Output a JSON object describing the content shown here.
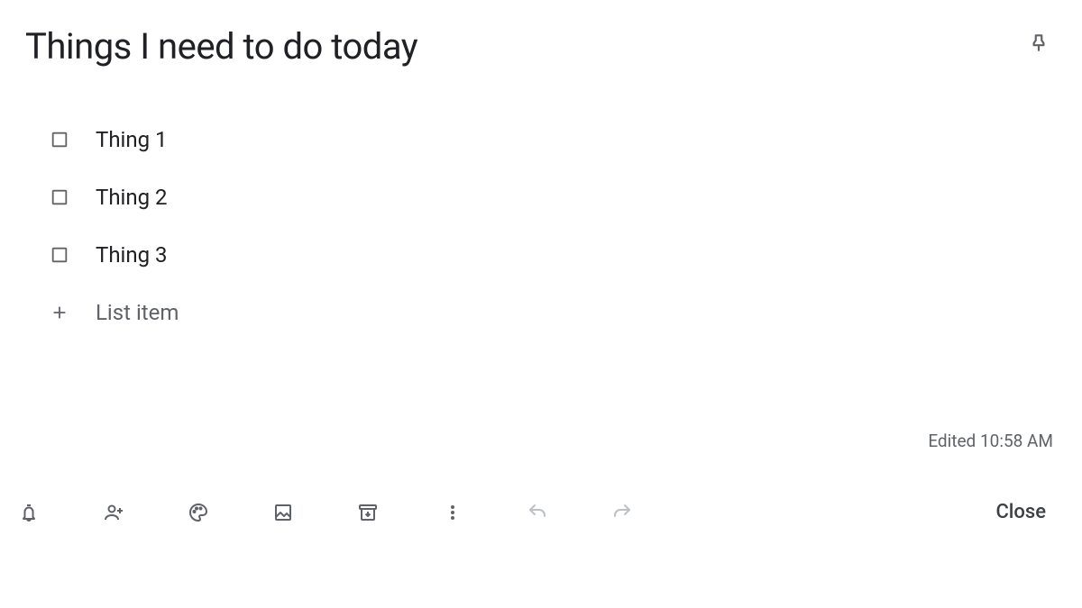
{
  "note": {
    "title": "Things I need to do today",
    "items": [
      {
        "text": "Thing 1"
      },
      {
        "text": "Thing 2"
      },
      {
        "text": "Thing 3"
      }
    ],
    "add_item_placeholder": "List item",
    "edited_label": "Edited 10:58 AM"
  },
  "toolbar": {
    "close_label": "Close"
  }
}
